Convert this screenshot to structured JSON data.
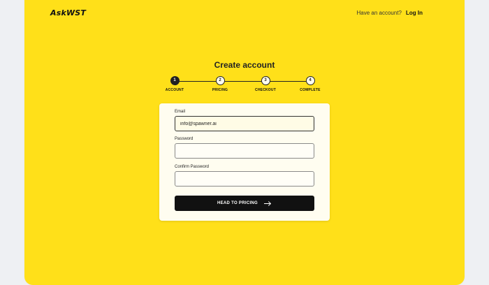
{
  "brand": {
    "logo": "AskWST"
  },
  "header": {
    "account_prompt": "Have an account?",
    "login_label": "Log In"
  },
  "page": {
    "title": "Create account"
  },
  "stepper": {
    "steps": [
      {
        "number": "1",
        "label": "ACCOUNT",
        "active": true
      },
      {
        "number": "2",
        "label": "PRICING",
        "active": false
      },
      {
        "number": "3",
        "label": "CHECKOUT",
        "active": false
      },
      {
        "number": "4",
        "label": "COMPLETE",
        "active": false
      }
    ]
  },
  "form": {
    "email_label": "Email",
    "email_value": "info@spawner.ai",
    "password_label": "Password",
    "password_value": "",
    "confirm_label": "Confirm Password",
    "confirm_value": "",
    "submit_label": "HEAD TO PRICING",
    "submit_icon": "arrow-right-icon"
  },
  "colors": {
    "background": "#ffe019",
    "card": "#fffdf0",
    "button": "#111111",
    "page_bg": "#eef0f3"
  }
}
